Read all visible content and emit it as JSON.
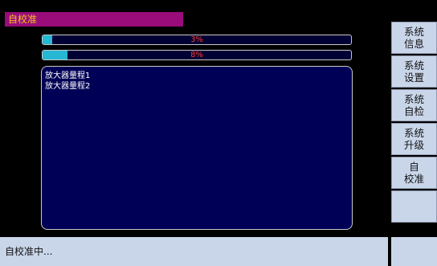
{
  "window": {
    "title": "自校准"
  },
  "progress": [
    {
      "label": "3%",
      "value": 0.03
    },
    {
      "label": "8%",
      "value": 0.08
    }
  ],
  "log": {
    "lines": [
      "放大器量程1",
      "放大器量程2"
    ]
  },
  "sidebar": {
    "buttons": [
      {
        "line1": "系统",
        "line2": "信息"
      },
      {
        "line1": "系统",
        "line2": "设置"
      },
      {
        "line1": "系统",
        "line2": "自检"
      },
      {
        "line1": "系统",
        "line2": "升级"
      },
      {
        "line1": "自",
        "line2": "校准"
      },
      {
        "line1": "",
        "line2": ""
      }
    ]
  },
  "status": {
    "text": "自校准中..."
  },
  "colors": {
    "title_bg": "#9a0c7a",
    "title_text": "#f0c419",
    "progress_fill": "#25b7d3",
    "percent_text": "#ff3b2f",
    "panel_bg": "#000056",
    "button_bg": "#c9d6ea"
  }
}
